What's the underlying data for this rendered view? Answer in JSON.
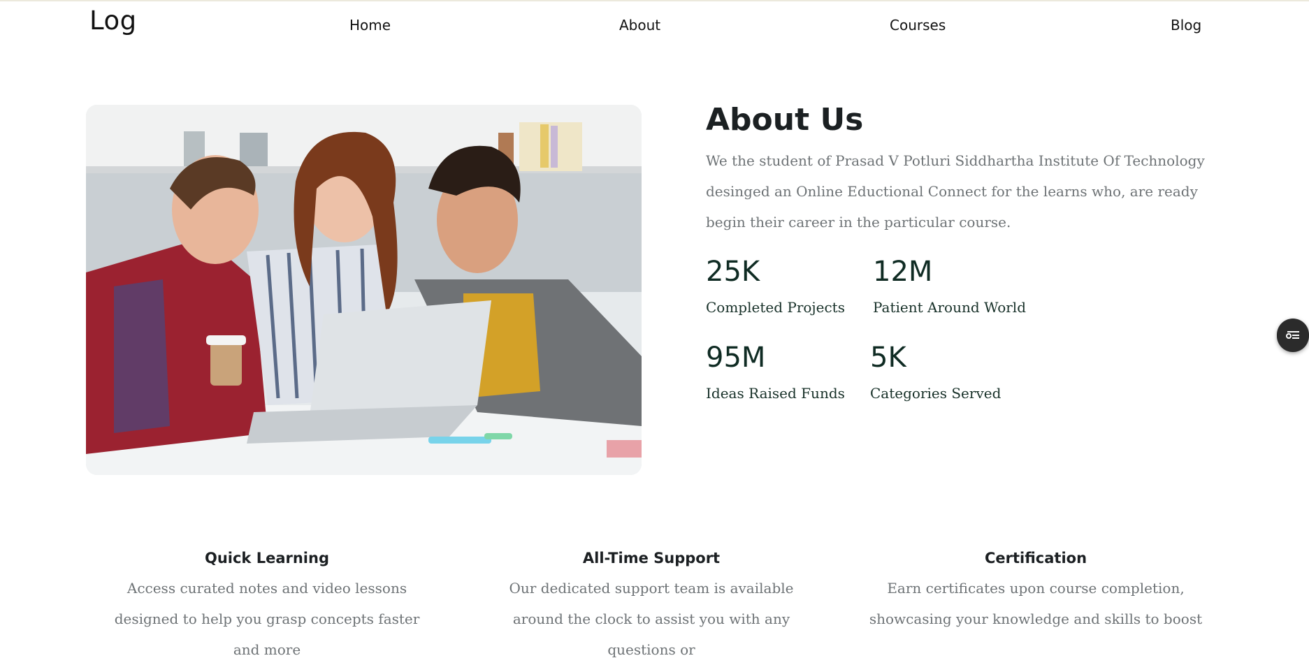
{
  "header": {
    "logo": "Log",
    "nav": [
      "Home",
      "About",
      "Courses",
      "Blog"
    ]
  },
  "hero_image": {
    "alt": "Three students looking at a laptop"
  },
  "about": {
    "title": "About Us",
    "description": "We the student of Prasad V Potluri Siddhartha Institute Of Technology desinged an Online Eductional Connect for the learns who, are ready begin their career in the particular course."
  },
  "stats": [
    {
      "value": "25K",
      "label": "Completed Projects"
    },
    {
      "value": "12M",
      "label": "Patient Around World"
    },
    {
      "value": "95M",
      "label": "Ideas Raised Funds"
    },
    {
      "value": "5K",
      "label": "Categories Served"
    }
  ],
  "features": [
    {
      "title": "Quick Learning",
      "text": "Access curated notes and video lessons designed to help you grasp concepts faster and more"
    },
    {
      "title": "All-Time Support",
      "text": "Our dedicated support team is available around the clock to assist you with any questions or"
    },
    {
      "title": "Certification",
      "text": "Earn certificates upon course completion, showcasing your knowledge and skills to boost"
    }
  ],
  "widget": {
    "icon": "list-settings-icon"
  },
  "colors": {
    "stat_text": "#0f2b23",
    "body_text": "#6d7275",
    "heading": "#1b2022"
  }
}
